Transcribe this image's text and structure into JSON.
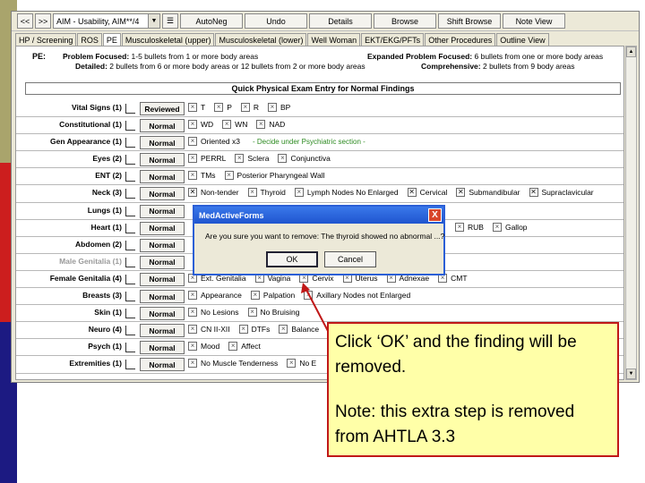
{
  "toolbar": {
    "back": "<<",
    "forward": ">>",
    "patient_select": "AIM - Usability, AIM**/4",
    "autoneg": "AutoNeg",
    "undo": "Undo",
    "details": "Details",
    "browse": "Browse",
    "shift_browse": "Shift Browse",
    "note_view": "Note View"
  },
  "tabs": [
    {
      "label": "HP / Screening"
    },
    {
      "label": "ROS"
    },
    {
      "label": "PE"
    },
    {
      "label": "Musculoskeletal (upper)"
    },
    {
      "label": "Musculoskeletal (lower)"
    },
    {
      "label": "Well Woman"
    },
    {
      "label": "EKT/EKG/PFTs"
    },
    {
      "label": "Other Procedures"
    },
    {
      "label": "Outline View"
    }
  ],
  "info": {
    "code": "PE:",
    "problem_focused_label": "Problem Focused:",
    "problem_focused_text": "1-5 bullets from 1 or more body areas",
    "detailed_label": "Detailed:",
    "detailed_text": "2 bullets from 6 or more body areas or 12 bullets from 2 or more body areas",
    "expanded_label": "Expanded Problem Focused:",
    "expanded_text": "6 bullets from one or more body areas",
    "comprehensive_label": "Comprehensive:",
    "comprehensive_text": "2 bullets from 9 body areas"
  },
  "quick_entry_title": "Quick Physical Exam Entry for Normal Findings",
  "rows": [
    {
      "label": "Vital Signs (1)",
      "button": "Reviewed",
      "items": [
        "T",
        "P",
        "R",
        "BP"
      ]
    },
    {
      "label": "Constitutional (1)",
      "button": "Normal",
      "items": [
        "WD",
        "WN",
        "NAD"
      ]
    },
    {
      "label": "Gen Appearance (1)",
      "button": "Normal",
      "items": [
        "Oriented x3"
      ],
      "note": "- Decide under Psychiatric section -"
    },
    {
      "label": "Eyes (2)",
      "button": "Normal",
      "items": [
        "PERRL",
        "Sclera",
        "Conjunctiva"
      ]
    },
    {
      "label": "ENT (2)",
      "button": "Normal",
      "items": [
        "TMs",
        "Posterior Pharyngeal Wall"
      ]
    },
    {
      "label": "Neck (3)",
      "button": "Normal",
      "items": [
        "Non-tender",
        "Thyroid",
        "Lymph Nodes No Enlarged",
        "Cervical",
        "Submandibular",
        "Supraclavicular"
      ]
    },
    {
      "label": "Lungs (1)",
      "button": "Normal",
      "items": []
    },
    {
      "label": "Heart (1)",
      "button": "Normal",
      "items": [
        "RUB",
        "Gallop"
      ]
    },
    {
      "label": "Abdomen (2)",
      "button": "Normal",
      "items": []
    },
    {
      "label": "Male Genitalia (1)",
      "button": "Normal",
      "items": []
    },
    {
      "label": "Female Genitalia (4)",
      "button": "Normal",
      "items": [
        "Ext. Genitalia",
        "Vagina",
        "Cervix",
        "Uterus",
        "Adnexae",
        "CMT"
      ]
    },
    {
      "label": "Breasts (3)",
      "button": "Normal",
      "items": [
        "Appearance",
        "Palpation",
        "Axillary Nodes not Enlarged"
      ]
    },
    {
      "label": "Skin (1)",
      "button": "Normal",
      "items": [
        "No Lesions",
        "No Bruising"
      ]
    },
    {
      "label": "Neuro (4)",
      "button": "Normal",
      "items": [
        "CN II-XII",
        "DTFs",
        "Balance"
      ]
    },
    {
      "label": "Psych (1)",
      "button": "Normal",
      "items": [
        "Mood",
        "Affect"
      ]
    },
    {
      "label": "Extremities (1)",
      "button": "Normal",
      "items": [
        "No Muscle Tenderness",
        "No E"
      ]
    }
  ],
  "dialog": {
    "title": "MedActiveForms",
    "close": "X",
    "message": "Are you sure you want to remove: The thyroid showed no abnormal ...?",
    "ok": "OK",
    "cancel": "Cancel"
  },
  "callout": {
    "line1": "Click ‘OK’ and the finding will be removed.",
    "line2": "Note: this extra step is removed from AHTLA 3.3"
  },
  "colors": {
    "strip_olive": "#a9a46c",
    "strip_red": "#cc1e1e",
    "strip_navy": "#1c1a82",
    "callout_bg": "#ffffa8",
    "callout_border": "#c01818",
    "dialog_title": "#2b5fd6"
  }
}
